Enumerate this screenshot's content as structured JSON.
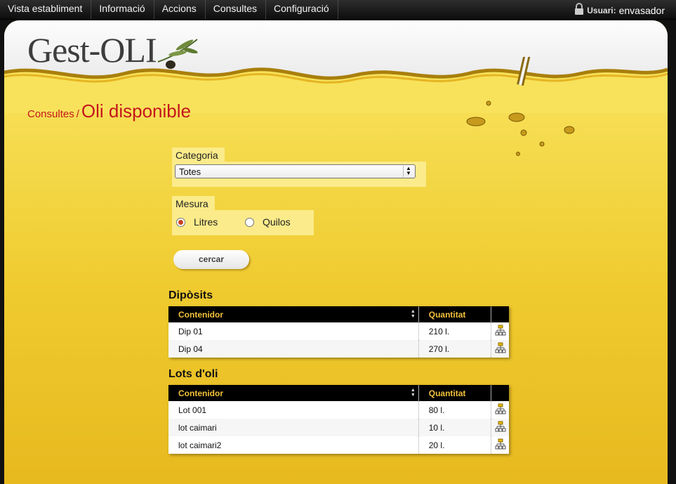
{
  "nav": {
    "items": [
      "Vista establiment",
      "Informació",
      "Accions",
      "Consultes",
      "Configuració"
    ]
  },
  "user": {
    "label": "Usuari:",
    "name": "envasador"
  },
  "logo": {
    "text": "Gest-OLI"
  },
  "breadcrumb": {
    "parent": "Consultes",
    "separator": "/",
    "title": "Oli disponible"
  },
  "form": {
    "categoria": {
      "label": "Categoria",
      "selected": "Totes"
    },
    "mesura": {
      "label": "Mesura",
      "options": [
        {
          "label": "Litres",
          "checked": true
        },
        {
          "label": "Quilos",
          "checked": false
        }
      ]
    },
    "search_label": "cercar"
  },
  "diposits": {
    "title": "Dipòsits",
    "headers": [
      "Contenidor",
      "Quantitat"
    ],
    "rows": [
      {
        "contenidor": "Dip 01",
        "quantitat": "210 l."
      },
      {
        "contenidor": "Dip 04",
        "quantitat": "270 l."
      }
    ]
  },
  "lots": {
    "title": "Lots d'oli",
    "headers": [
      "Contenidor",
      "Quantitat"
    ],
    "rows": [
      {
        "contenidor": "Lot 001",
        "quantitat": "80 l."
      },
      {
        "contenidor": "lot caimari",
        "quantitat": "10 l."
      },
      {
        "contenidor": "lot caimari2",
        "quantitat": "20 l."
      }
    ]
  },
  "icons": {
    "user": "lock-icon",
    "row_action": "tree-structure-icon",
    "sort": "sort-arrows-icon"
  },
  "colors": {
    "accent": "#c4161c",
    "header_text": "#f1c13a",
    "oil": "#f6dd52"
  }
}
